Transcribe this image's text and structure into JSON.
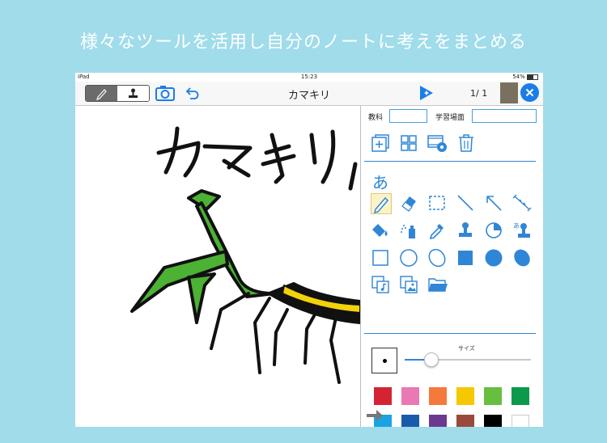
{
  "headline": "様々なツールを活用し自分のノートに考えをまとめる",
  "status_bar": {
    "device": "iPad",
    "time": "15:23",
    "battery": "54%"
  },
  "toolbar": {
    "title": "カマキリ",
    "page_indicator": "1/ 1"
  },
  "canvas": {
    "handwriting": "カマキリ"
  },
  "panel": {
    "subject_label": "教科",
    "subject_value": "",
    "scene_label": "学習場面",
    "scene_value": "",
    "text_tool": "あ",
    "size_label": "サイズ",
    "pen_size_fraction": 0.2
  },
  "colors": {
    "accent": "#2f86d6",
    "background": "#a0dcea",
    "mantis_green": "#4cb233",
    "palette": [
      "#d42433",
      "#e978b4",
      "#f5793a",
      "#f5c800",
      "#68bf3f",
      "#0a9a4a",
      "#1aa3e0",
      "#1a5aaa",
      "#6a3a8e",
      "#9a4a3a",
      "#000000",
      "#ffffff"
    ]
  },
  "icons": [
    "pencil-icon",
    "stamp-icon",
    "camera-icon",
    "undo-icon",
    "add-page-icon",
    "close-icon",
    "new-page-icon",
    "grid-view-icon",
    "film-settings-icon",
    "trash-icon"
  ]
}
